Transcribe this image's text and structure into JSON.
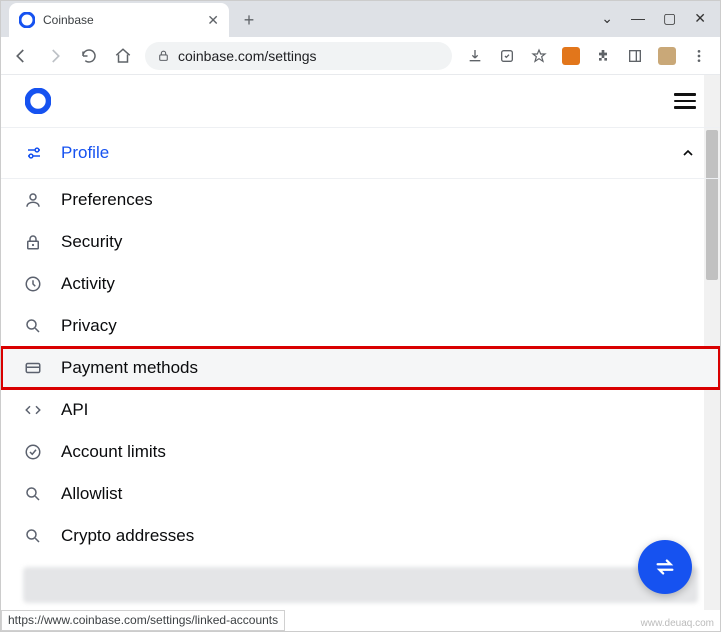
{
  "browser": {
    "tab_title": "Coinbase",
    "url_display": "coinbase.com/settings",
    "status_url": "https://www.coinbase.com/settings/linked-accounts",
    "watermark": "www.deuaq.com"
  },
  "header": {
    "section_label": "Profile"
  },
  "menu": {
    "items": [
      {
        "label": "Preferences",
        "icon": "user-icon"
      },
      {
        "label": "Security",
        "icon": "lock-icon"
      },
      {
        "label": "Activity",
        "icon": "clock-icon"
      },
      {
        "label": "Privacy",
        "icon": "search-icon"
      },
      {
        "label": "Payment methods",
        "icon": "card-icon",
        "highlight": true
      },
      {
        "label": "API",
        "icon": "code-icon"
      },
      {
        "label": "Account limits",
        "icon": "check-circle-icon"
      },
      {
        "label": "Allowlist",
        "icon": "search-icon"
      },
      {
        "label": "Crypto addresses",
        "icon": "search-icon"
      }
    ]
  }
}
